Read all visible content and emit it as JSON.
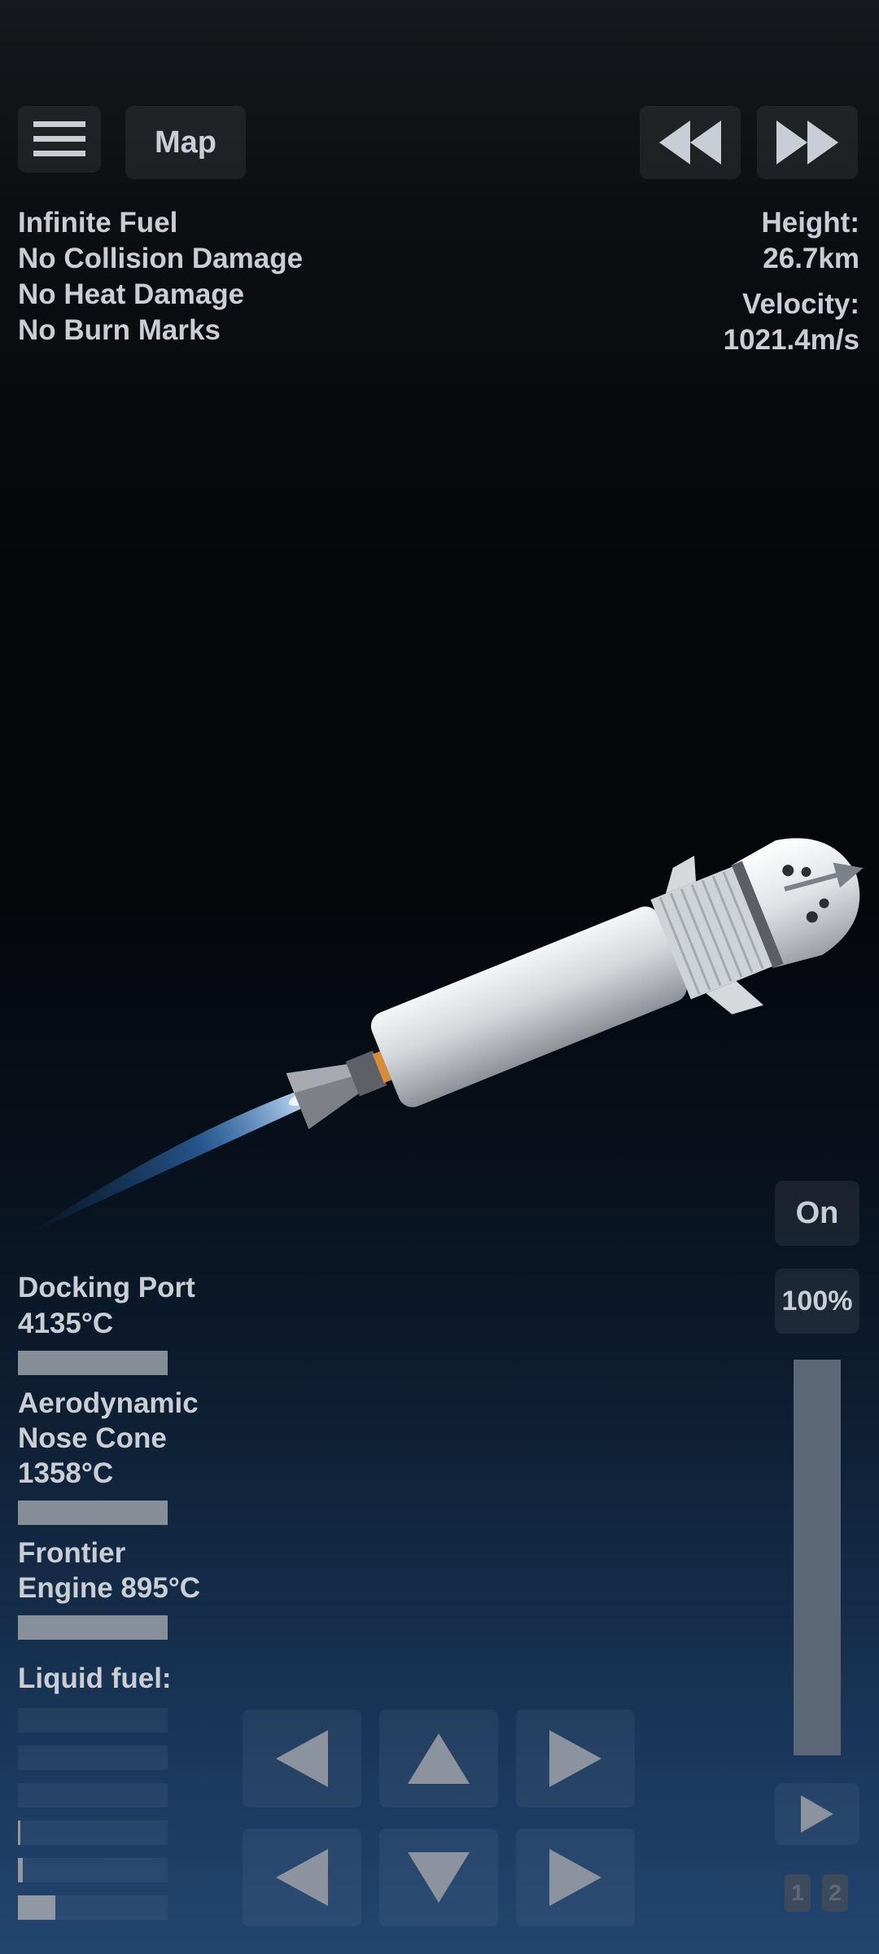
{
  "top_bar": {
    "menu_icon": "hamburger-icon",
    "map_label": "Map",
    "rewind_icon": "rewind-icon",
    "fast_forward_icon": "fast-forward-icon"
  },
  "cheats": [
    "Infinite Fuel",
    "No Collision Damage",
    "No Heat Damage",
    "No Burn Marks"
  ],
  "telemetry": {
    "height_label": "Height:",
    "height_value": "26.7km",
    "velocity_label": "Velocity:",
    "velocity_value": "1021.4m/s"
  },
  "heat_parts": [
    {
      "line1": "Docking Port",
      "line2": "4135°C",
      "line3": ""
    },
    {
      "line1": "Aerodynamic",
      "line2": "Nose Cone",
      "line3": "1358°C"
    },
    {
      "line1": "Frontier",
      "line2": "Engine 895°C",
      "line3": ""
    }
  ],
  "fuel": {
    "label": "Liquid fuel:",
    "tanks_fraction": [
      0,
      0,
      0,
      0.01,
      0.03,
      0.25
    ]
  },
  "right_panel": {
    "engine_toggle_label": "On",
    "throttle_label": "100%",
    "throttle_fraction": 1.0,
    "play_icon": "play-icon",
    "stage_1": "1",
    "stage_2": "2"
  },
  "controls": {
    "icons": [
      "rotate-left-icon",
      "up-icon",
      "rotate-right-icon",
      "left-icon",
      "down-icon",
      "right-icon"
    ]
  },
  "colors": {
    "text": "#c9ced4",
    "exhaust": "#5aa7ff",
    "hull": "#d9dcdf"
  }
}
